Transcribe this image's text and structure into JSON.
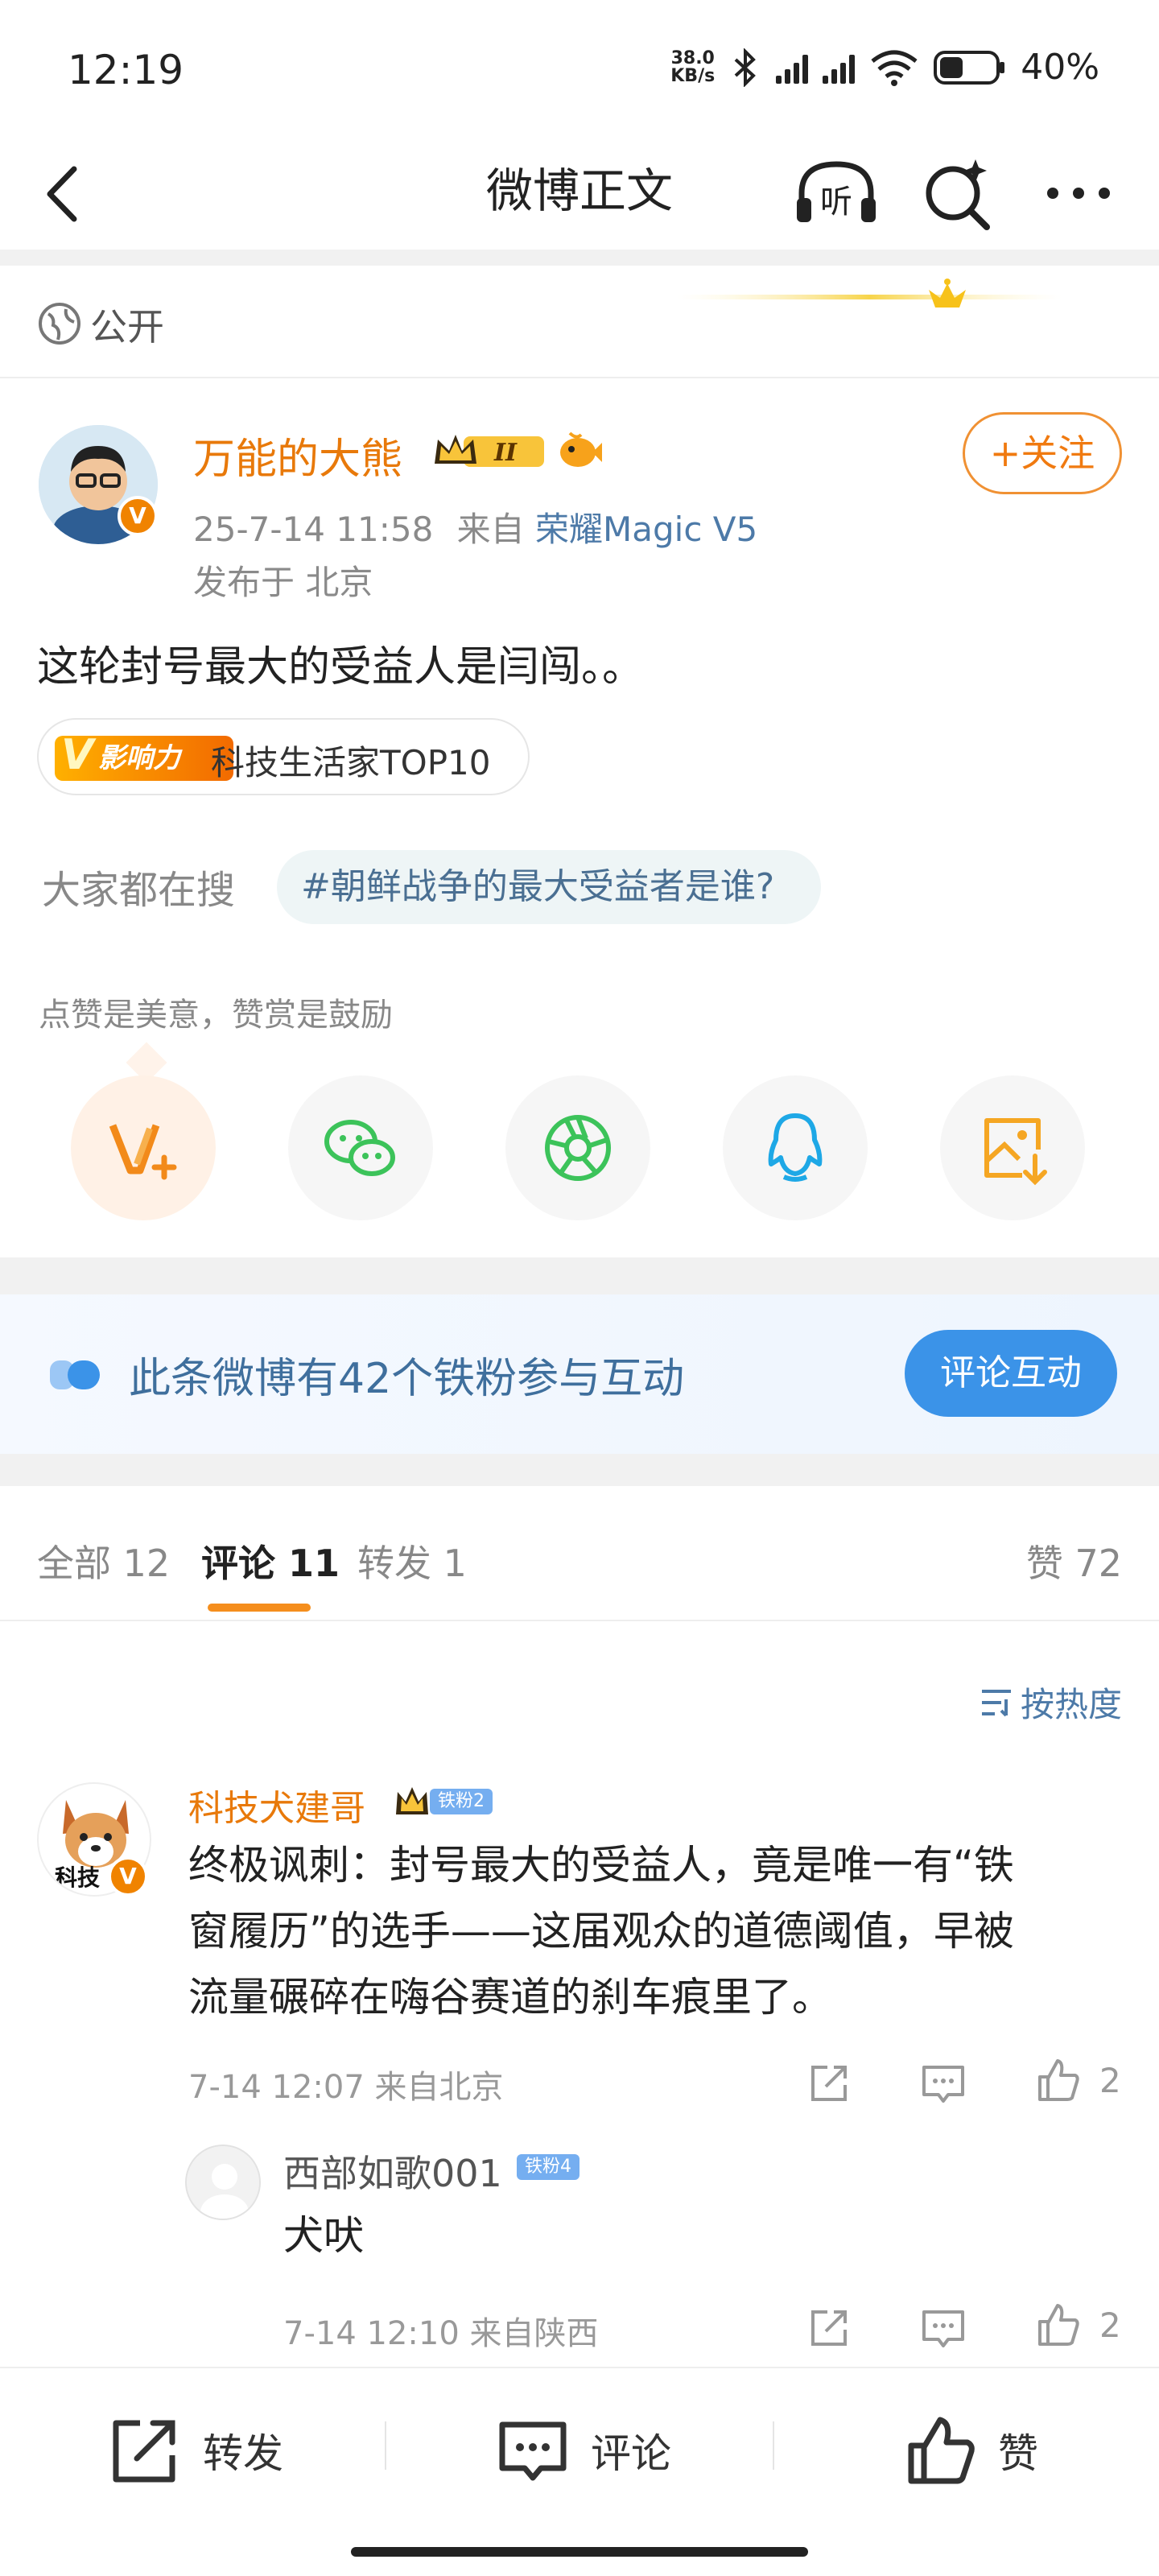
{
  "status_bar": {
    "time": "12:19",
    "net_speed_value": "38.0",
    "net_speed_unit": "KB/s",
    "battery": "40%"
  },
  "nav": {
    "title": "微博正文",
    "listen_label": "听"
  },
  "visibility": "公开",
  "post": {
    "author": "万能的大熊",
    "level_badge": "II",
    "verified_mark": "V",
    "follow_label": "+关注",
    "time": "25-7-14 11:58",
    "source_prefix": "来自",
    "device": "荣耀Magic V5",
    "location": "发布于 北京",
    "text": "这轮封号最大的受益人是闫闯。。",
    "influence_badge": "影响力",
    "influence_badge_letter": "V",
    "influence_text": "科技生活家TOP10",
    "search_label": "大家都在搜",
    "search_tag": "#朝鲜战争的最大受益者是谁?",
    "tip": "点赞是美意，赞赏是鼓励"
  },
  "fans_banner": {
    "text": "此条微博有42个铁粉参与互动",
    "button": "评论互动"
  },
  "tabs": {
    "all": "全部 12",
    "comments": "评论 11",
    "reposts": "转发 1",
    "likes": "赞 72"
  },
  "sort_label": "按热度",
  "comments": [
    {
      "name": "科技犬建哥",
      "fan_badge": "铁粉2",
      "avatar_text": "科技",
      "lines": [
        "终极讽刺：封号最大的受益人，竟是唯一有“铁",
        "窗履历”的选手——这届观众的道德阈值，早被",
        "流量碾碎在嗨谷赛道的刹车痕里了。"
      ],
      "meta": "7-14 12:07  来自北京",
      "likes": "2",
      "reply": {
        "name": "西部如歌001",
        "fan_badge": "铁粉4",
        "text": "犬吠",
        "meta": "7-14 12:10  来自陕西",
        "likes": "2"
      }
    }
  ],
  "bottom_bar": {
    "repost": "转发",
    "comment": "评论",
    "like": "赞"
  },
  "colors": {
    "accent_orange": "#e8790a",
    "link_blue": "#4d7aa8",
    "button_blue": "#3b93e8"
  }
}
